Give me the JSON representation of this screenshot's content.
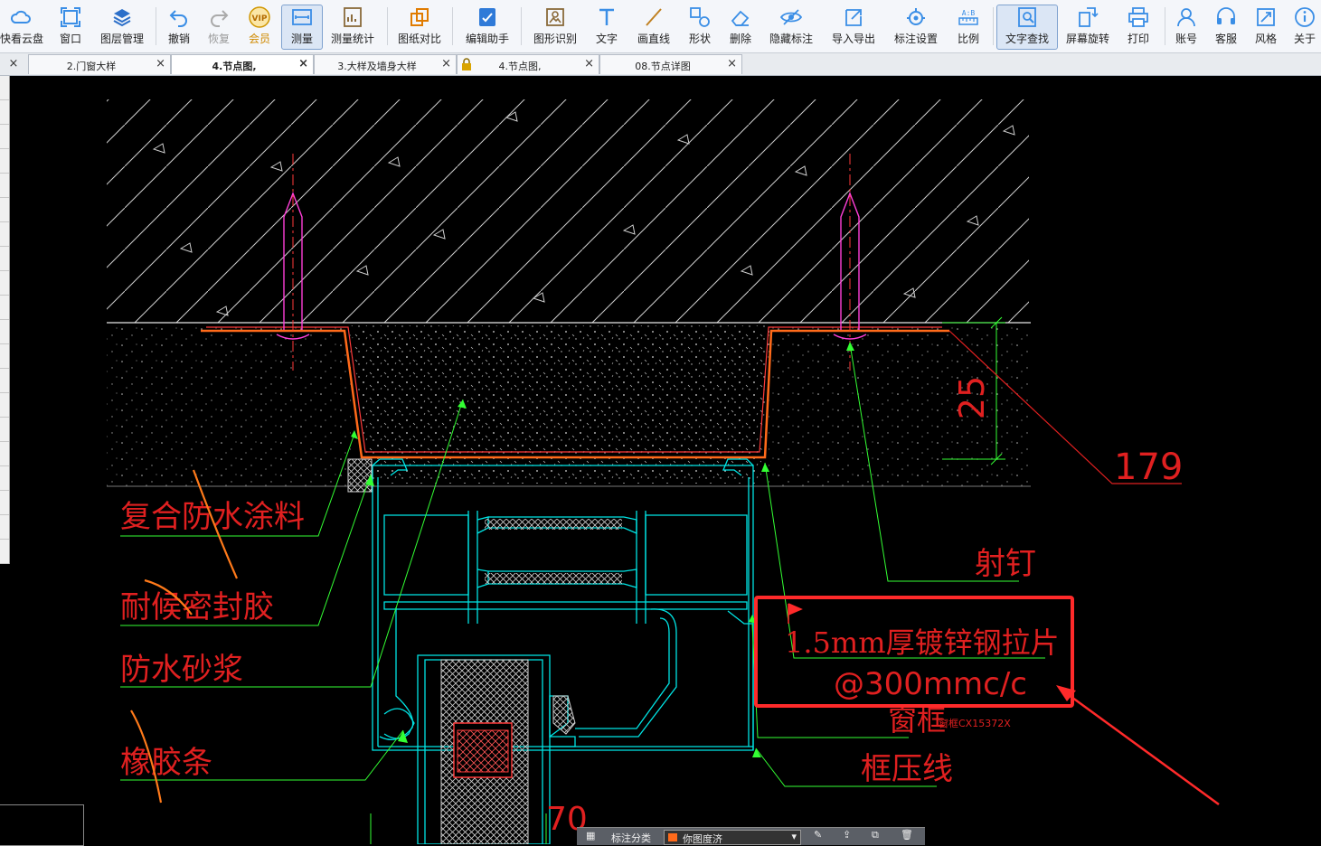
{
  "toolbar": {
    "items": [
      {
        "label": "快看云盘",
        "icon": "cloud-icon"
      },
      {
        "label": "窗口",
        "icon": "window-icon"
      },
      {
        "label": "图层管理",
        "icon": "layers-icon"
      },
      {
        "label": "撤销",
        "icon": "undo-icon"
      },
      {
        "label": "恢复",
        "icon": "redo-icon"
      },
      {
        "label": "会员",
        "icon": "vip-icon"
      },
      {
        "label": "测量",
        "icon": "measure-icon"
      },
      {
        "label": "测量统计",
        "icon": "measure-stats-icon"
      },
      {
        "label": "图纸对比",
        "icon": "compare-icon"
      },
      {
        "label": "编辑助手",
        "icon": "edit-assistant-icon"
      },
      {
        "label": "图形识别",
        "icon": "shape-recognition-icon"
      },
      {
        "label": "文字",
        "icon": "text-icon"
      },
      {
        "label": "画直线",
        "icon": "line-icon"
      },
      {
        "label": "形状",
        "icon": "shape-icon"
      },
      {
        "label": "删除",
        "icon": "eraser-icon"
      },
      {
        "label": "隐藏标注",
        "icon": "hide-annotation-icon"
      },
      {
        "label": "导入导出",
        "icon": "import-export-icon"
      },
      {
        "label": "标注设置",
        "icon": "annotation-settings-icon"
      },
      {
        "label": "比例",
        "icon": "scale-icon"
      },
      {
        "label": "文字查找",
        "icon": "text-search-icon"
      },
      {
        "label": "屏幕旋转",
        "icon": "rotate-icon"
      },
      {
        "label": "打印",
        "icon": "print-icon"
      },
      {
        "label": "账号",
        "icon": "account-icon"
      },
      {
        "label": "客服",
        "icon": "headset-icon"
      },
      {
        "label": "风格",
        "icon": "style-icon"
      },
      {
        "label": "关于",
        "icon": "info-icon"
      }
    ],
    "vip_text": "VIP"
  },
  "tabs": [
    {
      "label": "2.门窗大样",
      "active": false,
      "locked": false
    },
    {
      "label": "4.节点图,",
      "active": true,
      "locked": false
    },
    {
      "label": "3.大样及墙身大样",
      "active": false,
      "locked": false
    },
    {
      "label": "4.节点图,",
      "active": false,
      "locked": true
    },
    {
      "label": "08.节点详图",
      "active": false,
      "locked": false
    }
  ],
  "close_symbol": "×",
  "drawing": {
    "labels": {
      "waterproof_coating": "复合防水涂料",
      "sealant": "耐候密封胶",
      "waterproof_mortar": "防水砂浆",
      "rubber_strip": "橡胶条",
      "nail": "射钉",
      "steel_strip": "1.5mm厚镀锌钢拉片",
      "spacing": "@300mmc/c",
      "window_frame": "窗框",
      "frame_code": "窗框CX15372X",
      "bead": "框压线"
    },
    "dimensions": {
      "dim_25": "25",
      "dim_179": "179",
      "dim_70": "70"
    },
    "colors": {
      "background": "#000000",
      "text_red": "#e02020",
      "leader_green": "#33ff33",
      "frame_cyan": "#00e5e5",
      "orange": "#ff6a1a",
      "magenta": "#ff3fd8",
      "highlight_box": "#ff2a2a"
    }
  },
  "bottom_bar": {
    "label": "标注分类",
    "select_value": "你图度济"
  }
}
